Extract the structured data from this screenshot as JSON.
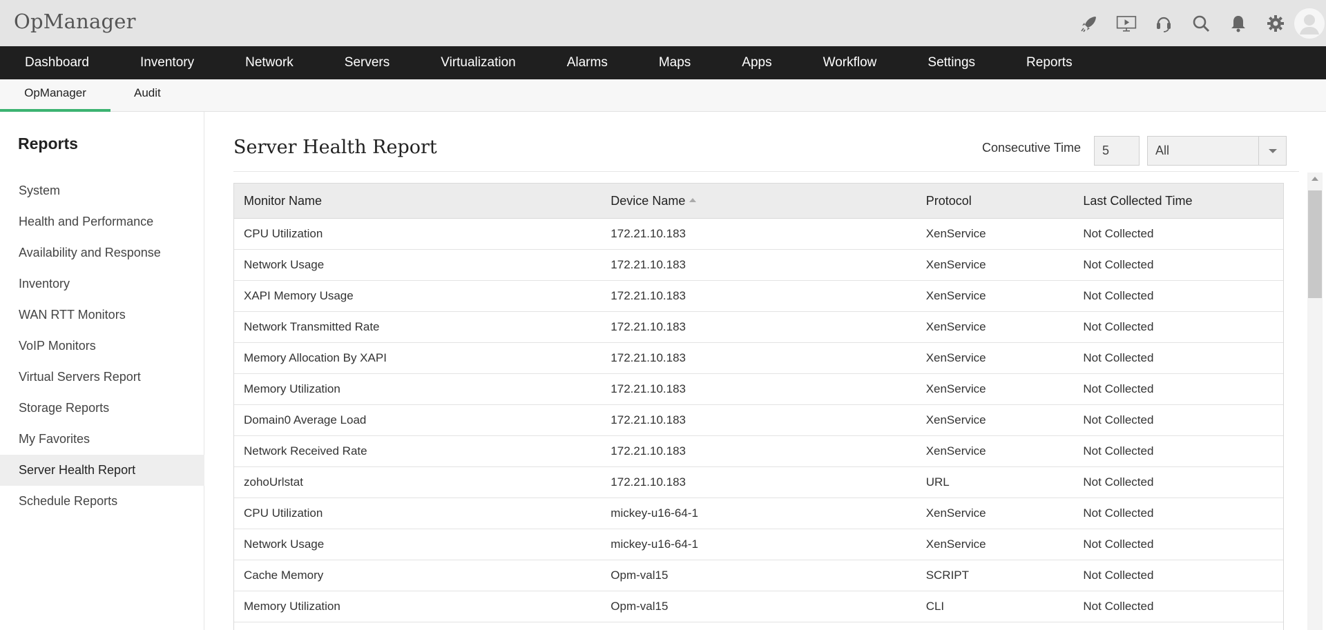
{
  "app": {
    "title": "OpManager"
  },
  "top_icons": [
    {
      "name": "rocket-icon"
    },
    {
      "name": "presentation-icon"
    },
    {
      "name": "support-headset-icon"
    },
    {
      "name": "search-icon"
    },
    {
      "name": "bell-icon"
    },
    {
      "name": "gear-icon"
    },
    {
      "name": "avatar-icon"
    }
  ],
  "main_nav": [
    "Dashboard",
    "Inventory",
    "Network",
    "Servers",
    "Virtualization",
    "Alarms",
    "Maps",
    "Apps",
    "Workflow",
    "Settings",
    "Reports"
  ],
  "sub_nav": {
    "tabs": [
      "OpManager",
      "Audit"
    ],
    "active": "OpManager"
  },
  "sidebar": {
    "title": "Reports",
    "items": [
      "System",
      "Health and Performance",
      "Availability and Response",
      "Inventory",
      "WAN RTT Monitors",
      "VoIP Monitors",
      "Virtual Servers Report",
      "Storage Reports",
      "My Favorites",
      "Server Health Report",
      "Schedule Reports"
    ],
    "active": "Server Health Report"
  },
  "report": {
    "title": "Server Health Report",
    "consecutive_time_label": "Consecutive Time",
    "consecutive_time_value": "5",
    "filter_value": "All"
  },
  "table": {
    "columns": [
      "Monitor Name",
      "Device Name",
      "Protocol",
      "Last Collected Time"
    ],
    "sorted_column": "Device Name",
    "rows": [
      [
        "CPU Utilization",
        "172.21.10.183",
        "XenService",
        "Not Collected"
      ],
      [
        "Network Usage",
        "172.21.10.183",
        "XenService",
        "Not Collected"
      ],
      [
        "XAPI Memory Usage",
        "172.21.10.183",
        "XenService",
        "Not Collected"
      ],
      [
        "Network Transmitted Rate",
        "172.21.10.183",
        "XenService",
        "Not Collected"
      ],
      [
        "Memory Allocation By XAPI",
        "172.21.10.183",
        "XenService",
        "Not Collected"
      ],
      [
        "Memory Utilization",
        "172.21.10.183",
        "XenService",
        "Not Collected"
      ],
      [
        "Domain0 Average Load",
        "172.21.10.183",
        "XenService",
        "Not Collected"
      ],
      [
        "Network Received Rate",
        "172.21.10.183",
        "XenService",
        "Not Collected"
      ],
      [
        "zohoUrlstat",
        "172.21.10.183",
        "URL",
        "Not Collected"
      ],
      [
        "CPU Utilization",
        "mickey-u16-64-1",
        "XenService",
        "Not Collected"
      ],
      [
        "Network Usage",
        "mickey-u16-64-1",
        "XenService",
        "Not Collected"
      ],
      [
        "Cache Memory",
        "Opm-val15",
        "SCRIPT",
        "Not Collected"
      ],
      [
        "Memory Utilization",
        "Opm-val15",
        "CLI",
        "Not Collected"
      ],
      [
        "",
        "",
        "",
        ""
      ]
    ]
  },
  "colors": {
    "accent": "#3cb371",
    "nav_bg": "#1f1f1f",
    "topbar_bg": "#e4e4e4"
  }
}
